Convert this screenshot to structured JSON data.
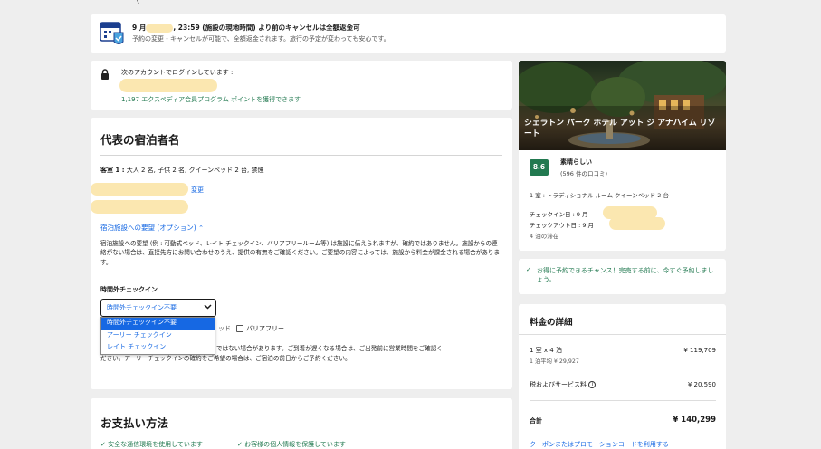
{
  "cancel": {
    "heading_pre": "9 月",
    "heading_post": ", 23:59 (施設の現地時間) より前のキャンセルは全額返金可",
    "sub": "予約の変更・キャンセルが可能で、全額返金されます。旅行の予定が変わっても安心です。"
  },
  "login": {
    "label": "次のアカウントでログインしています :",
    "points": "1,197 エクスペディア会員プログラム ポイントを獲得できます"
  },
  "guest": {
    "title": "代表の宿泊者名",
    "room_label": "客室 1 :",
    "room_desc": " 大人 2 名, 子供 2 名, クイーンベッド 2 台, 禁煙",
    "change_link": "変更",
    "request_toggle": "宿泊施設への要望 (オプション)",
    "request_caret": "⌃",
    "request_note": "宿泊施設への要望 (例 : 可動式ベッド、レイト チェックイン、バリアフリールーム等) は施設に伝えられますが、確約ではありません。施設からの連絡がない場合は、直接先方にお問い合わせのうえ、提供の有無をご確認ください。ご要望の内容によっては、施設から料金が課金される場合があります。",
    "checkin_label": "時間外チェックイン",
    "select_value": "時間外チェックイン不要",
    "options": [
      "時間外チェックイン不要",
      "アーリー チェックイン",
      "レイト チェックイン"
    ],
    "partial_checkbox_text": "ッド",
    "barrier_free": "バリアフリー",
    "note2_line1": "ではない場合があります。ご到着が遅くなる場合は、ご出発前に営業時間をご確認く",
    "note2_line2": "ださい。アーリーチェックインの確約をご希望の場合は、ご宿泊の前日からご予約ください。"
  },
  "payment": {
    "title": "お支払い方法",
    "badge1": "安全な通信環境を使用しています",
    "badge2": "お客様の個人情報を保護しています"
  },
  "hotel": {
    "name": "シェラトン パーク ホテル アット ジ アナハイム リゾート",
    "rating": "8.6",
    "rating_word": "素晴らしい",
    "reviews": "(596 件のロコミ)",
    "room": "1 室 : トラディショナル ルーム クイーンベッド 2 台",
    "checkin": "チェックイン日 : 9 月",
    "checkout": "チェックアウト日 : 9 月",
    "nights": "4 泊の滞在"
  },
  "promo": {
    "text": "お得に予約できるチャンス！完売する前に、今すぐ予約しましょう。"
  },
  "price": {
    "title": "料金の詳細",
    "rooms_label": "1 室 x 4 泊",
    "rooms_value": "¥ 119,709",
    "avg_label": "1 泊平均 ¥ 29,927",
    "tax_label": "税およびサービス料",
    "tax_value": "¥ 20,590",
    "total_label": "合計",
    "total_value": "¥ 140,299",
    "coupon": "クーポンまたはプロモーションコードを利用する"
  },
  "colors": {
    "accent": "#1668e3",
    "green": "#227950",
    "rating_bg": "#227950",
    "highlight": "#fbe7b0",
    "selected_option": "#1668e3"
  }
}
